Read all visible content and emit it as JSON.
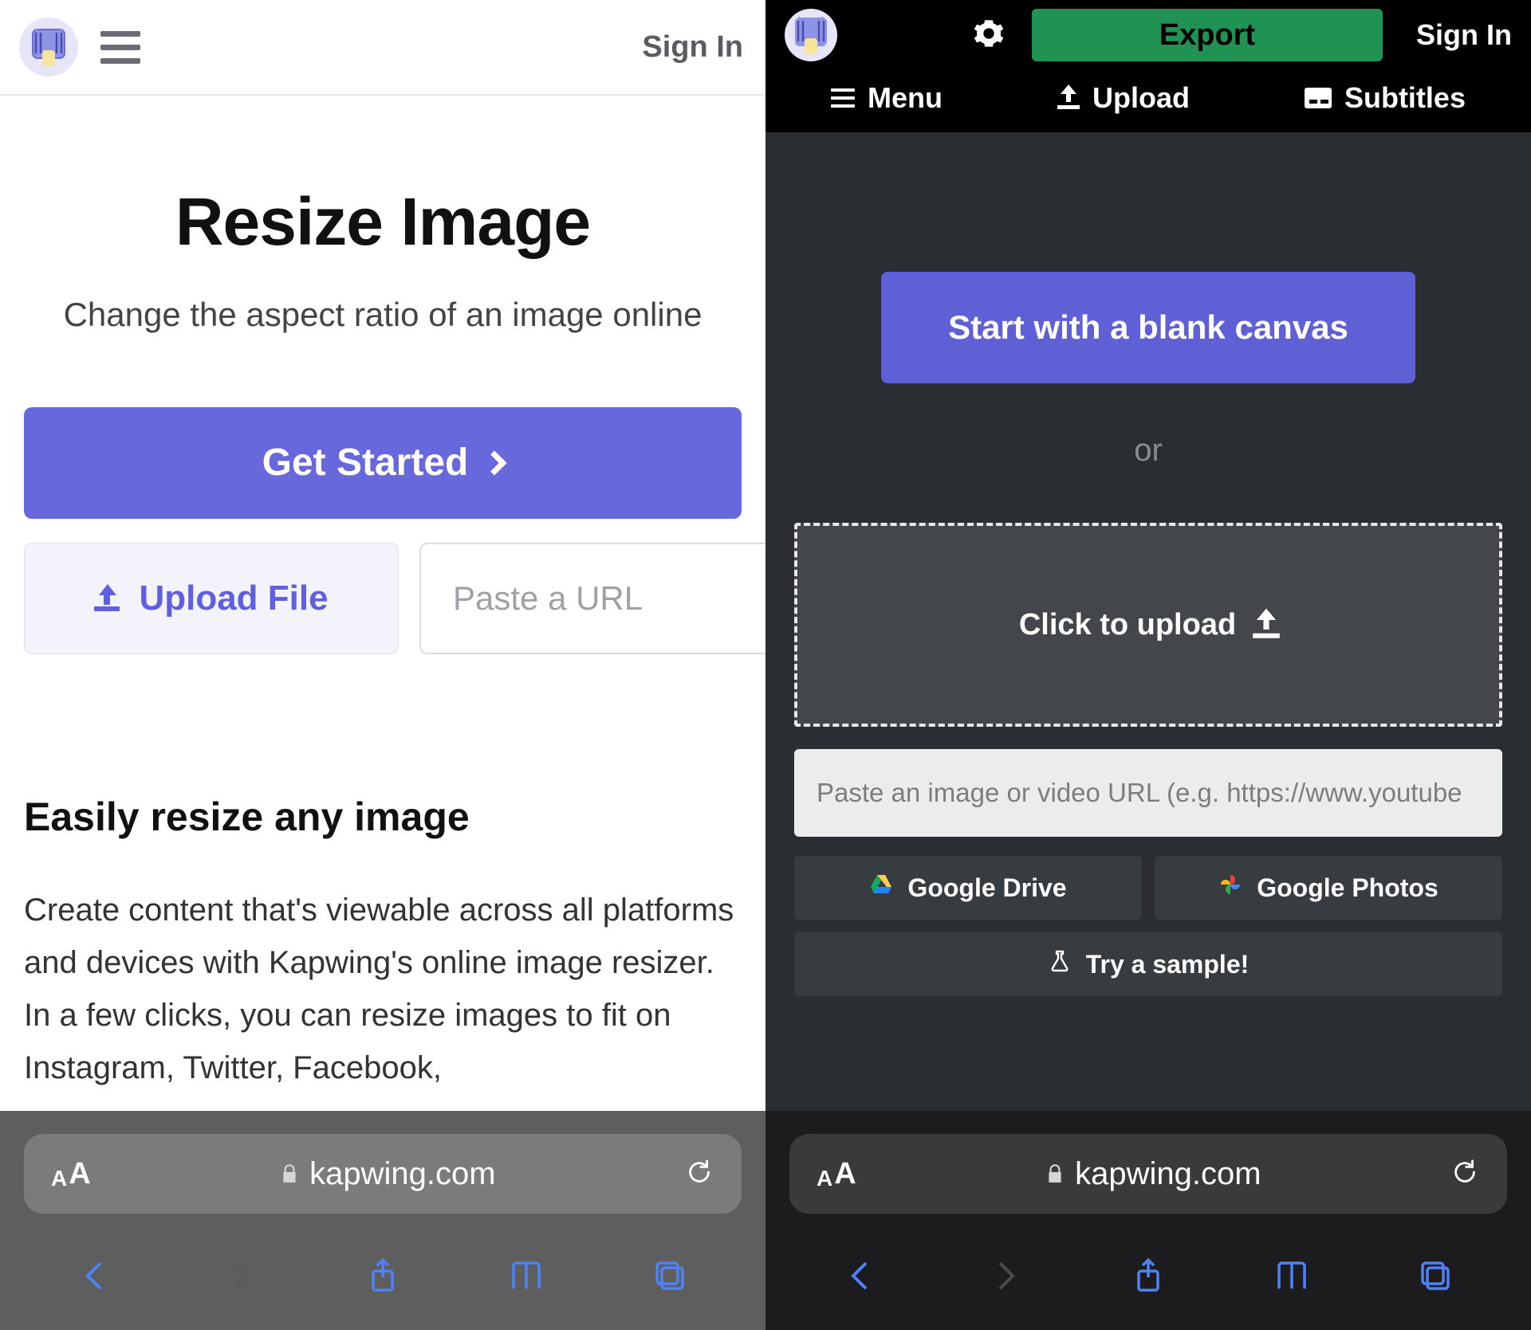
{
  "left": {
    "header": {
      "sign_in": "Sign In"
    },
    "title": "Resize Image",
    "subtitle": "Change the aspect ratio of an image online",
    "get_started": "Get Started",
    "upload_file": "Upload File",
    "url_placeholder": "Paste a URL",
    "section_heading": "Easily resize any image",
    "section_body": "Create content that's viewable across all platforms and devices with Kapwing's online image resizer. In a few clicks, you can resize images to fit on Instagram, Twitter, Facebook,"
  },
  "right": {
    "topbar": {
      "export": "Export",
      "sign_in": "Sign In"
    },
    "tabs": {
      "menu": "Menu",
      "upload": "Upload",
      "subtitles": "Subtitles"
    },
    "blank_canvas": "Start with a blank canvas",
    "or": "or",
    "dropzone": "Click to upload",
    "url_placeholder": "Paste an image or video URL (e.g. https://www.youtube",
    "google_drive": "Google Drive",
    "google_photos": "Google Photos",
    "try_sample": "Try a sample!"
  },
  "safari": {
    "domain": "kapwing.com"
  }
}
